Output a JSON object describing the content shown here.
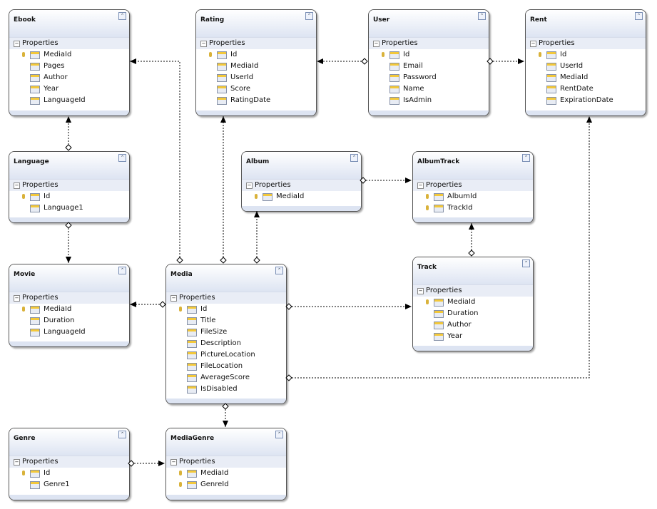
{
  "entities": [
    {
      "id": "ebook",
      "title": "Ebook",
      "section": "Properties",
      "props": [
        {
          "name": "MediaId",
          "key": true
        },
        {
          "name": "Pages"
        },
        {
          "name": "Author"
        },
        {
          "name": "Year"
        },
        {
          "name": "LanguageId"
        }
      ]
    },
    {
      "id": "rating",
      "title": "Rating",
      "section": "Properties",
      "props": [
        {
          "name": "Id",
          "key": true
        },
        {
          "name": "MediaId"
        },
        {
          "name": "UserId"
        },
        {
          "name": "Score"
        },
        {
          "name": "RatingDate"
        }
      ]
    },
    {
      "id": "user",
      "title": "User",
      "section": "Properties",
      "props": [
        {
          "name": "Id",
          "key": true
        },
        {
          "name": "Email"
        },
        {
          "name": "Password"
        },
        {
          "name": "Name"
        },
        {
          "name": "IsAdmin"
        }
      ]
    },
    {
      "id": "rent",
      "title": "Rent",
      "section": "Properties",
      "props": [
        {
          "name": "Id",
          "key": true
        },
        {
          "name": "UserId"
        },
        {
          "name": "MediaId"
        },
        {
          "name": "RentDate"
        },
        {
          "name": "ExpirationDate"
        }
      ]
    },
    {
      "id": "language",
      "title": "Language",
      "section": "Properties",
      "props": [
        {
          "name": "Id",
          "key": true
        },
        {
          "name": "Language1"
        }
      ]
    },
    {
      "id": "album",
      "title": "Album",
      "section": "Properties",
      "props": [
        {
          "name": "MediaId",
          "key": true
        }
      ]
    },
    {
      "id": "albumtrack",
      "title": "AlbumTrack",
      "section": "Properties",
      "props": [
        {
          "name": "AlbumId",
          "key": true
        },
        {
          "name": "TrackId",
          "key": true
        }
      ]
    },
    {
      "id": "movie",
      "title": "Movie",
      "section": "Properties",
      "props": [
        {
          "name": "MediaId",
          "key": true
        },
        {
          "name": "Duration"
        },
        {
          "name": "LanguageId"
        }
      ]
    },
    {
      "id": "media",
      "title": "Media",
      "section": "Properties",
      "props": [
        {
          "name": "Id",
          "key": true
        },
        {
          "name": "Title"
        },
        {
          "name": "FileSize"
        },
        {
          "name": "Description"
        },
        {
          "name": "PictureLocation"
        },
        {
          "name": "FileLocation"
        },
        {
          "name": "AverageScore"
        },
        {
          "name": "IsDisabled"
        }
      ]
    },
    {
      "id": "track",
      "title": "Track",
      "section": "Properties",
      "props": [
        {
          "name": "MediaId",
          "key": true
        },
        {
          "name": "Duration"
        },
        {
          "name": "Author"
        },
        {
          "name": "Year"
        }
      ]
    },
    {
      "id": "genre",
      "title": "Genre",
      "section": "Properties",
      "props": [
        {
          "name": "Id",
          "key": true
        },
        {
          "name": "Genre1"
        }
      ]
    },
    {
      "id": "mediagenre",
      "title": "MediaGenre",
      "section": "Properties",
      "props": [
        {
          "name": "MediaId",
          "key": true
        },
        {
          "name": "GenreId",
          "key": true
        }
      ]
    }
  ],
  "associations": [
    {
      "from": "Media",
      "to": "Ebook"
    },
    {
      "from": "Language",
      "to": "Ebook"
    },
    {
      "from": "Language",
      "to": "Movie"
    },
    {
      "from": "Media",
      "to": "Rating"
    },
    {
      "from": "Media",
      "to": "Album"
    },
    {
      "from": "User",
      "to": "Rating"
    },
    {
      "from": "User",
      "to": "Rent"
    },
    {
      "from": "Album",
      "to": "AlbumTrack"
    },
    {
      "from": "Track",
      "to": "AlbumTrack"
    },
    {
      "from": "Media",
      "to": "Movie"
    },
    {
      "from": "Media",
      "to": "Track"
    },
    {
      "from": "Media",
      "to": "Rent"
    },
    {
      "from": "Media",
      "to": "MediaGenre"
    },
    {
      "from": "Genre",
      "to": "MediaGenre"
    }
  ],
  "colors": {
    "header": "#dde4f2",
    "section": "#e9edf6",
    "border": "#555555",
    "link": "#000000"
  }
}
